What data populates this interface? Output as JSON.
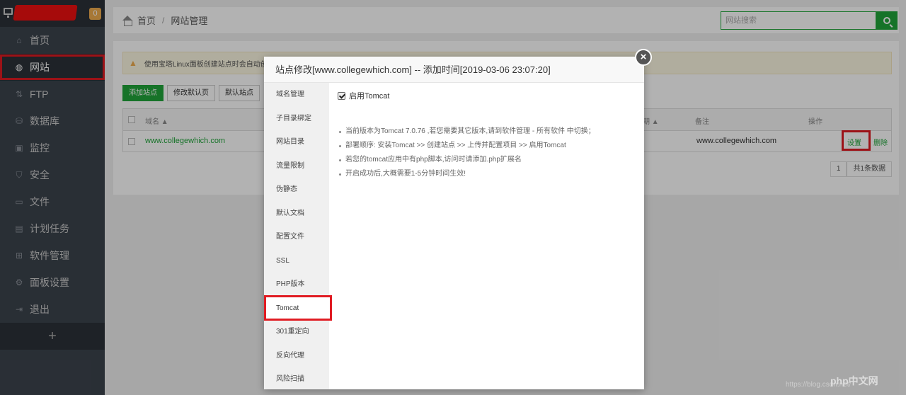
{
  "sidebar": {
    "badge": "0",
    "items": [
      {
        "label": "首页",
        "icon": "home-icon"
      },
      {
        "label": "网站",
        "icon": "globe-icon"
      },
      {
        "label": "FTP",
        "icon": "ftp-icon"
      },
      {
        "label": "数据库",
        "icon": "database-icon"
      },
      {
        "label": "监控",
        "icon": "monitor-icon"
      },
      {
        "label": "安全",
        "icon": "shield-icon"
      },
      {
        "label": "文件",
        "icon": "folder-icon"
      },
      {
        "label": "计划任务",
        "icon": "calendar-icon"
      },
      {
        "label": "软件管理",
        "icon": "apps-icon"
      },
      {
        "label": "面板设置",
        "icon": "gear-icon"
      },
      {
        "label": "退出",
        "icon": "logout-icon"
      }
    ],
    "add": "+"
  },
  "breadcrumb": {
    "home": "首页",
    "sep": "/",
    "current": "网站管理"
  },
  "search": {
    "placeholder": "网站搜索"
  },
  "alert": {
    "text": "使用宝塔Linux面板创建站点时会自动创"
  },
  "toolbar": {
    "add_site": "添加站点",
    "edit_default_page": "修改默认页",
    "default_site": "默认站点"
  },
  "table": {
    "headers": {
      "domain": "域名 ▲",
      "expire": "到期 ▲",
      "remark": "备注",
      "action": "操作"
    },
    "rows": [
      {
        "domain": "www.collegewhich.com",
        "remark": "www.collegewhich.com",
        "settings": "设置",
        "delete": "删除"
      }
    ]
  },
  "pager": {
    "page": "1",
    "total": "共1条数据"
  },
  "modal": {
    "title": "站点修改[www.collegewhich.com] -- 添加时间[2019-03-06 23:07:20]",
    "close": "×",
    "tabs": [
      "域名管理",
      "子目录绑定",
      "网站目录",
      "流量限制",
      "伪静态",
      "默认文档",
      "配置文件",
      "SSL",
      "PHP版本",
      "Tomcat",
      "301重定向",
      "反向代理",
      "风险扫描"
    ],
    "tomcat_checkbox": "启用Tomcat",
    "tips": [
      "当前版本为Tomcat 7.0.76 ,若您需要其它版本,请到软件管理 - 所有软件 中切换；",
      "部署顺序: 安装Tomcat >> 创建站点 >> 上传并配置项目 >> 启用Tomcat",
      "若您的tomcat应用中有php脚本,访问时请添加.php扩展名",
      "开启成功后,大概需要1-5分钟时间生效!"
    ]
  },
  "watermark": {
    "url": "https://blog.csdn.net/",
    "logo": "php中文网"
  },
  "colors": {
    "accent": "#20a53a",
    "highlight": "#e01b22",
    "sidebar": "#3c444d"
  }
}
